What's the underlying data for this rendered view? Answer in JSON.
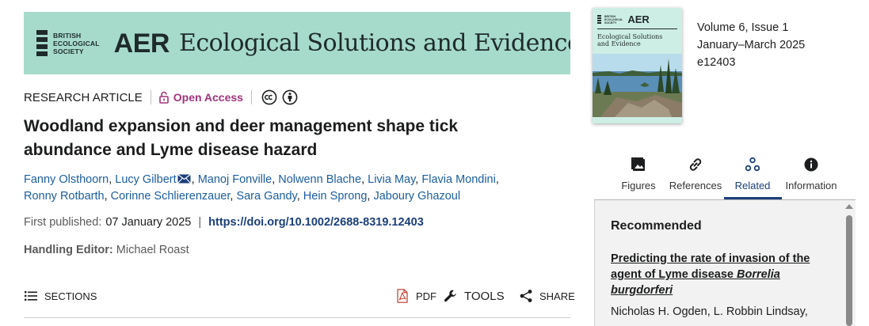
{
  "banner": {
    "society_line1": "BRITISH",
    "society_line2": "ECOLOGICAL",
    "society_line3": "SOCIETY",
    "aer": "AER",
    "journal_title": "Ecological Solutions and Evidence",
    "background_color": "#a6dbcc"
  },
  "article": {
    "type": "RESEARCH ARTICLE",
    "access_label": "Open Access",
    "title": "Woodland expansion and deer management shape tick abundance and Lyme disease hazard",
    "authors": [
      "Fanny Olsthoorn",
      "Lucy Gilbert",
      "Manoj Fonville",
      "Nolwenn Blache",
      "Livia May",
      "Flavia Mondini",
      "Ronny Rotbarth",
      "Corinne Schlierenzauer",
      "Sara Gandy",
      "Hein Sprong",
      "Jaboury Ghazoul"
    ],
    "first_published_label": "First published:",
    "first_published_date": "07 January 2025",
    "pub_separator": "|",
    "doi": "https://doi.org/10.1002/2688-8319.12403",
    "editor_label": "Handling Editor:",
    "editor_name": "Michael Roast"
  },
  "toolbar": {
    "sections": "SECTIONS",
    "pdf": "PDF",
    "tools": "TOOLS",
    "share": "SHARE"
  },
  "cover": {
    "aer": "AER",
    "title_line1": "Ecological Solutions",
    "title_line2": "and Evidence"
  },
  "issue": {
    "volume": "Volume 6, Issue 1",
    "dates": "January–March 2025",
    "article_id": "e12403"
  },
  "tabs": {
    "figures": "Figures",
    "references": "References",
    "related": "Related",
    "information": "Information",
    "active": "Related"
  },
  "recommended": {
    "heading": "Recommended",
    "title_plain": "Predicting the rate of invasion of the agent of Lyme disease ",
    "title_italic": "Borrelia burgdorferi",
    "authors": "Nicholas H. Ogden, L. Robbin Lindsay,"
  },
  "colors": {
    "link": "#1b5e9e",
    "doi": "#1b3f7a",
    "open_access": "#a0347c",
    "active_tab": "#1b3f7a"
  }
}
